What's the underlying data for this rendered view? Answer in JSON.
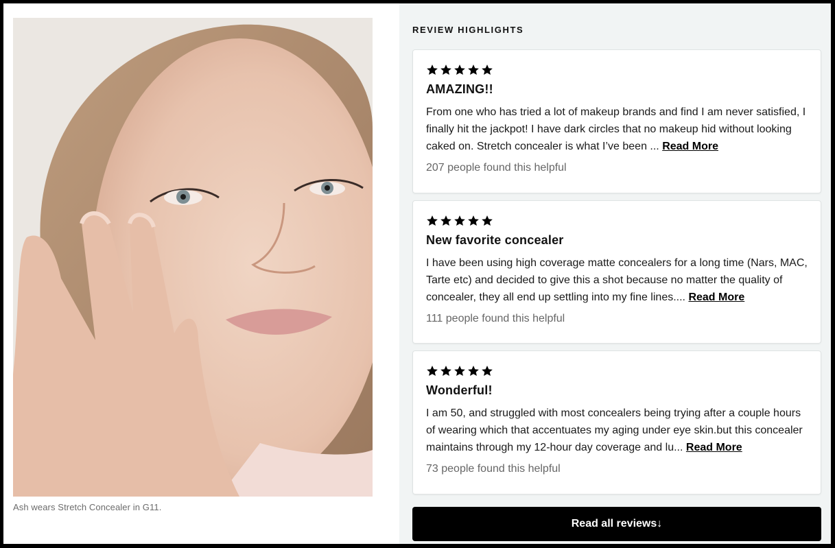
{
  "photo": {
    "alt": "Model applying concealer under eye",
    "caption": "Ash wears Stretch Concealer in G11."
  },
  "reviews_section": {
    "title": "REVIEW HIGHLIGHTS",
    "reviews": [
      {
        "rating": 5,
        "max_rating": 5,
        "title": "AMAZING!!",
        "body": "From one who has tried a lot of makeup brands and find I am never satisfied, I finally hit the jackpot! I have dark circles that no makeup hid without looking caked on. Stretch concealer is what I’ve been ... ",
        "read_more_label": "Read More",
        "helpful_text": "207 people found this helpful"
      },
      {
        "rating": 5,
        "max_rating": 5,
        "title": "New favorite concealer",
        "body": "I have been using high coverage matte concealers for a long time (Nars, MAC, Tarte etc) and decided to give this a shot because no matter the quality of concealer, they all end up settling into my fine lines.... ",
        "read_more_label": "Read More",
        "helpful_text": "111 people found this helpful"
      },
      {
        "rating": 5,
        "max_rating": 5,
        "title": "Wonderful!",
        "body": "I am 50, and struggled with most concealers being trying after a couple hours of wearing which that accentuates my aging under eye skin.but this concealer maintains through my 12-hour day coverage and lu... ",
        "read_more_label": "Read More",
        "helpful_text": "73 people found this helpful"
      }
    ],
    "read_all_label": "Read all reviews↓"
  },
  "colors": {
    "panel_bg": "#f1f4f4",
    "button_bg": "#000000",
    "button_text": "#ffffff",
    "star": "#000000"
  }
}
